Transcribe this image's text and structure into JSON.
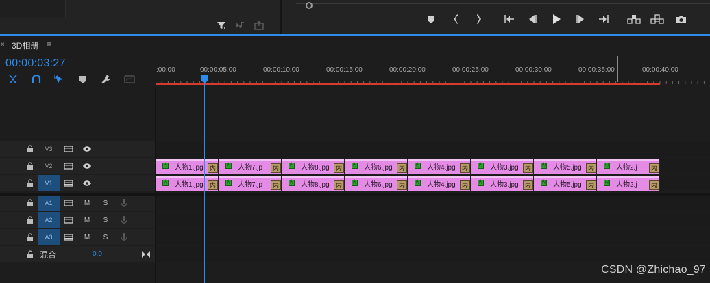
{
  "sequence_tab": {
    "close_glyph": "×",
    "title": "3D相册",
    "menu_glyph": "≡"
  },
  "timecode": "00:00:03:27",
  "source_toolbar_icons": [
    "filter-icon",
    "audio-note-icon",
    "export-frame-icon"
  ],
  "transport_icons": [
    "marker-icon",
    "mark-in-icon",
    "mark-out-icon",
    "go-to-in-icon",
    "step-back-icon",
    "play-icon",
    "step-forward-icon",
    "go-to-out-icon",
    "lift-icon",
    "extract-icon",
    "camera-icon"
  ],
  "timeline_tools": [
    "snap-icon",
    "magnet-link-icon",
    "linked-select-icon",
    "add-marker-icon",
    "wrench-icon",
    "captions-icon"
  ],
  "ruler_labels": [
    ":00:00",
    "00:00:05:00",
    "00:00:10:00",
    "00:00:15:00",
    "00:00:20:00",
    "00:00:25:00",
    "00:00:30:00",
    "00:00:35:00",
    "00:00:40:00"
  ],
  "video_tracks": [
    {
      "name": "V3",
      "active": false
    },
    {
      "name": "V2",
      "active": false
    },
    {
      "name": "V1",
      "active": true
    }
  ],
  "audio_tracks": [
    {
      "name": "A1",
      "m": "M",
      "s": "S"
    },
    {
      "name": "A2",
      "m": "M",
      "s": "S"
    },
    {
      "name": "A3",
      "m": "M",
      "s": "S"
    }
  ],
  "mix": {
    "label": "混合",
    "value": "0.0"
  },
  "clips_v2": [
    {
      "label": "人物1.jpg",
      "badge": "内",
      "fx": "内"
    },
    {
      "label": "人物7.jp",
      "badge": "内",
      "fx": "内"
    },
    {
      "label": "人物8.jpg",
      "badge": "内",
      "fx": "内"
    },
    {
      "label": "人物6.jpg",
      "badge": "内",
      "fx": "内"
    },
    {
      "label": "人物4.jpg",
      "badge": "内",
      "fx": "内"
    },
    {
      "label": "人物3.jpg",
      "badge": "内",
      "fx": "内"
    },
    {
      "label": "人物5.jpg",
      "badge": "内",
      "fx": "内"
    },
    {
      "label": "人物2.j",
      "badge": "内",
      "fx": "内"
    }
  ],
  "clips_v1": [
    {
      "label": "人物1.jpg",
      "badge": "内",
      "fx": "内"
    },
    {
      "label": "人物7.jp",
      "badge": "内",
      "fx": "内"
    },
    {
      "label": "人物8.jpg",
      "badge": "内",
      "fx": "内"
    },
    {
      "label": "人物6.jpg",
      "badge": "内",
      "fx": "内"
    },
    {
      "label": "人物4.jpg",
      "badge": "内",
      "fx": "内"
    },
    {
      "label": "人物3.jpg",
      "badge": "内",
      "fx": "内"
    },
    {
      "label": "人物5.jpg",
      "badge": "内",
      "fx": "内"
    },
    {
      "label": "人物2.j",
      "badge": "内",
      "fx": "内"
    }
  ],
  "watermark": "CSDN @Zhichao_97",
  "colors": {
    "accent": "#2d8ceb",
    "clip": "#e48be6",
    "work_area": "#d63a2e",
    "active_track": "#1e4e7c"
  }
}
